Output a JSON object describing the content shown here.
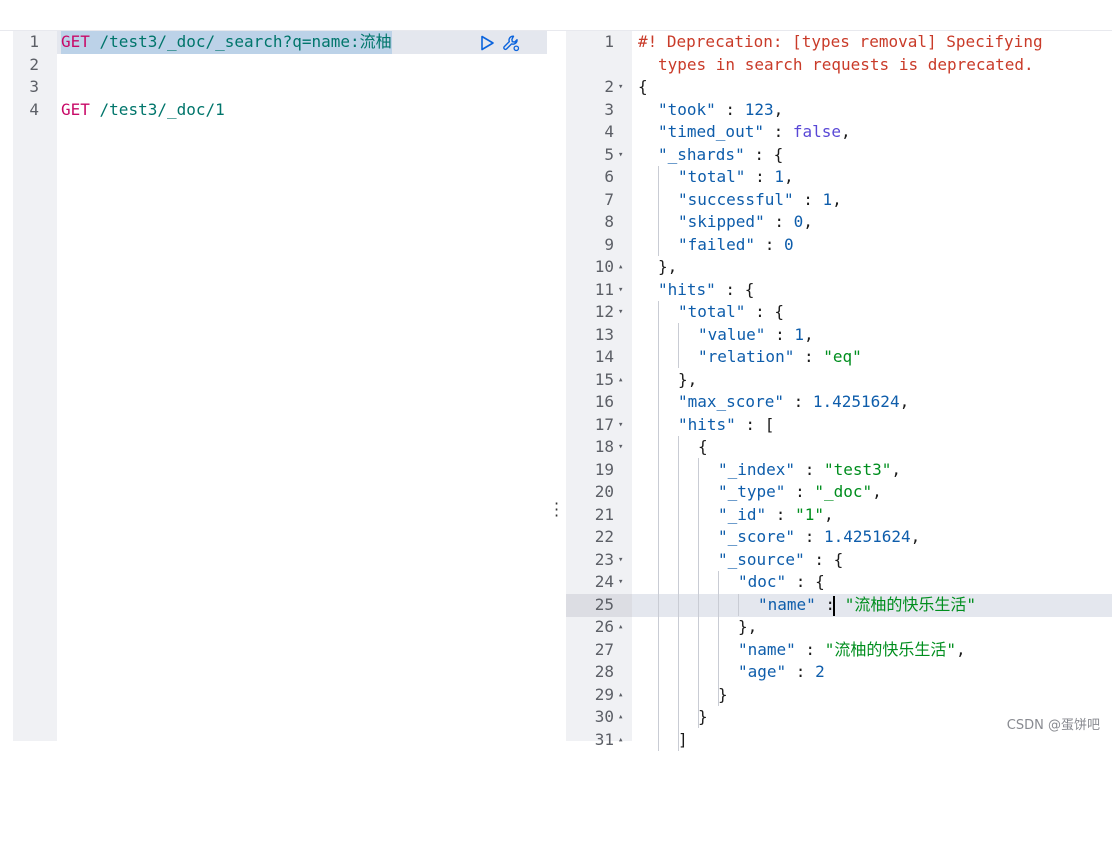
{
  "left_editor": {
    "lines": [
      {
        "num": "1",
        "method": "GET",
        "path": " /test3/_doc/_search?q=name:流柚"
      },
      {
        "num": "2",
        "method": "",
        "path": ""
      },
      {
        "num": "3",
        "method": "",
        "path": ""
      },
      {
        "num": "4",
        "method": "GET",
        "path": " /test3/_doc/1"
      }
    ],
    "run_icon": "play-icon",
    "settings_icon": "wrench-icon"
  },
  "right_editor": {
    "line_numbers": [
      "1",
      "",
      "2",
      "3",
      "4",
      "5",
      "6",
      "7",
      "8",
      "9",
      "10",
      "11",
      "12",
      "13",
      "14",
      "15",
      "16",
      "17",
      "18",
      "19",
      "20",
      "21",
      "22",
      "23",
      "24",
      "25",
      "26",
      "27",
      "28",
      "29",
      "30",
      "31"
    ],
    "warning_line1": "#! Deprecation: [types removal] Specifying",
    "warning_line2": "types in search requests is deprecated.",
    "lines": {
      "l2": "{",
      "took_key": "\"took\"",
      "took_val": "123",
      "timed_out_key": "\"timed_out\"",
      "timed_out_val": "false",
      "shards_key": "\"_shards\"",
      "total_key": "\"total\"",
      "total_val": "1",
      "successful_key": "\"successful\"",
      "successful_val": "1",
      "skipped_key": "\"skipped\"",
      "skipped_val": "0",
      "failed_key": "\"failed\"",
      "failed_val": "0",
      "close_shards": "},",
      "hits_key": "\"hits\"",
      "hits_total_key": "\"total\"",
      "value_key": "\"value\"",
      "value_val": "1",
      "relation_key": "\"relation\"",
      "relation_val": "\"eq\"",
      "close_total": "},",
      "max_score_key": "\"max_score\"",
      "max_score_val": "1.4251624",
      "inner_hits_key": "\"hits\"",
      "open_obj": "{",
      "index_key": "\"_index\"",
      "index_val": "\"test3\"",
      "type_key": "\"_type\"",
      "type_val": "\"_doc\"",
      "id_key": "\"_id\"",
      "id_val": "\"1\"",
      "score_key": "\"_score\"",
      "score_val": "1.4251624",
      "source_key": "\"_source\"",
      "doc_key": "\"doc\"",
      "doc_name_key": "\"name\"",
      "doc_name_val": "\"流柚的快乐生活\"",
      "close_doc": "},",
      "name_key": "\"name\"",
      "name_val": "\"流柚的快乐生活\"",
      "age_key": "\"age\"",
      "age_val": "2",
      "close_source": "}",
      "close_hit": "}",
      "close_arr": "]"
    }
  },
  "watermark": "CSDN @蛋饼吧"
}
